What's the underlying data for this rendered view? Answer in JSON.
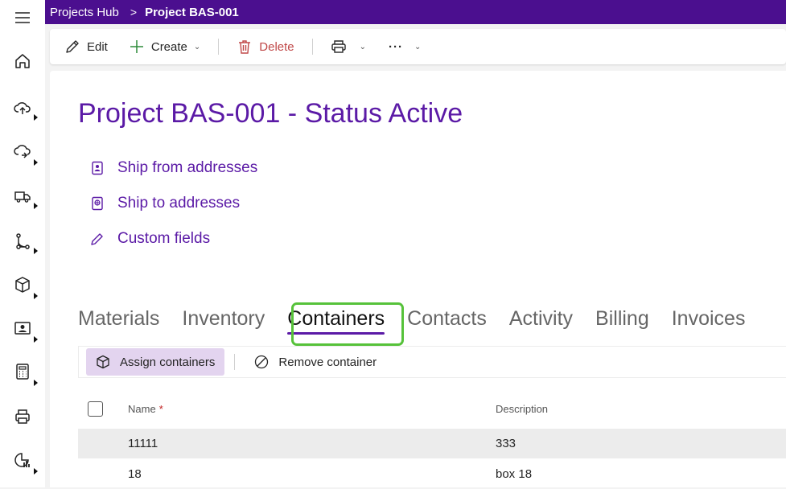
{
  "breadcrumb": {
    "root": "Projects Hub",
    "separator": ">",
    "current": "Project BAS-001"
  },
  "commands": {
    "edit": "Edit",
    "create": "Create",
    "delete": "Delete",
    "chevron": "⌄",
    "more": "···"
  },
  "page": {
    "title": "Project BAS-001 - Status Active"
  },
  "links": [
    {
      "label": "Ship from addresses",
      "icon": "address-book-icon"
    },
    {
      "label": "Ship to addresses",
      "icon": "globe-book-icon"
    },
    {
      "label": "Custom fields",
      "icon": "pencil-icon"
    }
  ],
  "tabs": [
    "Materials",
    "Inventory",
    "Containers",
    "Contacts",
    "Activity",
    "Billing",
    "Invoices"
  ],
  "active_tab": "Containers",
  "grid_toolbar": {
    "assign": "Assign containers",
    "remove": "Remove container"
  },
  "table": {
    "columns": {
      "name": "Name",
      "required_mark": "*",
      "description": "Description"
    },
    "rows": [
      {
        "name": "11111",
        "description": "333"
      },
      {
        "name": "18",
        "description": "box 18"
      }
    ]
  },
  "colors": {
    "topbar": "#4b0f8f",
    "accent": "#5b1aa6",
    "highlight": "#56c23a",
    "delete": "#c04848"
  },
  "rail_icons": [
    "hamburger-menu-icon",
    "home-icon",
    "upload-cloud-icon",
    "download-cloud-icon",
    "truck-icon",
    "workflow-icon",
    "box-icon",
    "contact-card-icon",
    "calculator-icon",
    "printer-icon",
    "report-chart-icon"
  ]
}
